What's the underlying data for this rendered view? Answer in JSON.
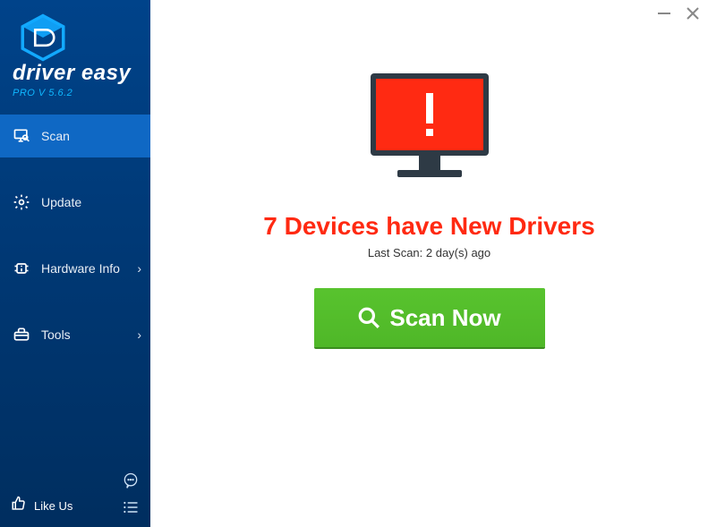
{
  "window": {
    "minimize_icon": "minimize",
    "close_icon": "close"
  },
  "brand": {
    "name": "driver easy",
    "version": "PRO V 5.6.2"
  },
  "sidebar": {
    "items": [
      {
        "id": "scan",
        "label": "Scan",
        "icon": "monitor-search-icon",
        "active": true,
        "has_chevron": false
      },
      {
        "id": "update",
        "label": "Update",
        "icon": "gear-icon",
        "active": false,
        "has_chevron": false
      },
      {
        "id": "hardware-info",
        "label": "Hardware Info",
        "icon": "chip-info-icon",
        "active": false,
        "has_chevron": true
      },
      {
        "id": "tools",
        "label": "Tools",
        "icon": "toolbox-icon",
        "active": false,
        "has_chevron": true
      }
    ],
    "like_label": "Like Us",
    "chat_icon": "chat-icon",
    "list_icon": "list-icon"
  },
  "main": {
    "headline": "7 Devices have New Drivers",
    "last_scan": "Last Scan: 2 day(s) ago",
    "scan_button": "Scan Now",
    "alert_icon": "monitor-alert-icon"
  },
  "colors": {
    "accent": "#0f68c4",
    "sidebar_bg_top": "#00438a",
    "sidebar_bg_bottom": "#002e5f",
    "danger": "#ff2a12",
    "scan_green": "#4fb728"
  }
}
